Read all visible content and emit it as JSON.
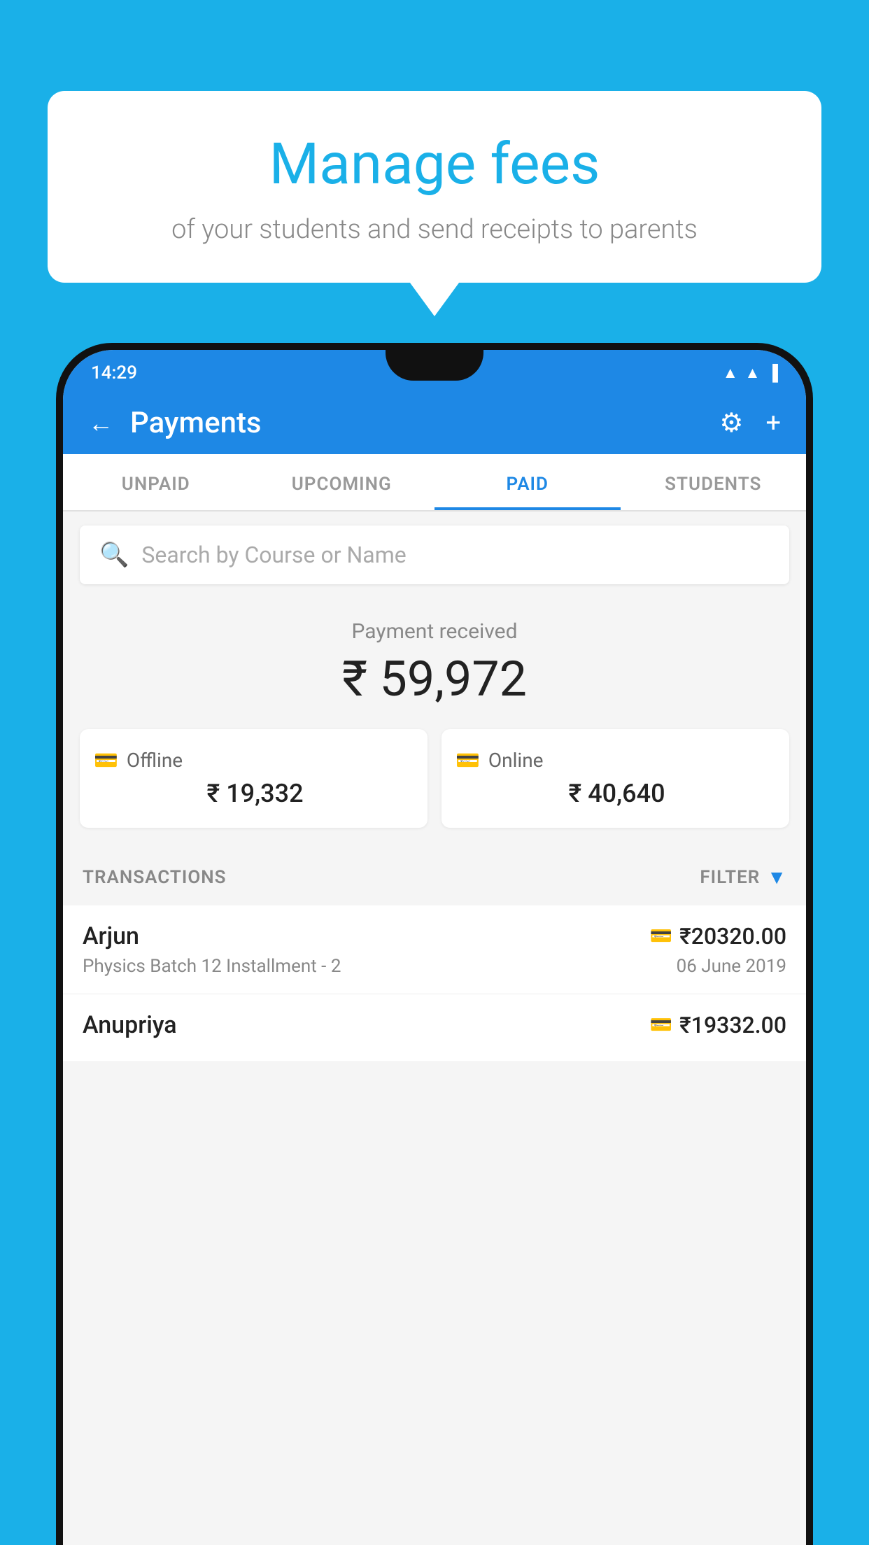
{
  "background_color": "#1ab0e8",
  "bubble": {
    "title": "Manage fees",
    "subtitle": "of your students and send receipts to parents"
  },
  "status_bar": {
    "time": "14:29",
    "wifi": "▲",
    "signal": "▲",
    "battery": "▐"
  },
  "app_bar": {
    "title": "Payments",
    "back_label": "←",
    "gear_symbol": "⚙",
    "plus_symbol": "+"
  },
  "tabs": [
    {
      "label": "UNPAID",
      "active": false
    },
    {
      "label": "UPCOMING",
      "active": false
    },
    {
      "label": "PAID",
      "active": true
    },
    {
      "label": "STUDENTS",
      "active": false
    }
  ],
  "search": {
    "placeholder": "Search by Course or Name"
  },
  "payment_summary": {
    "label": "Payment received",
    "amount": "₹ 59,972",
    "offline_label": "Offline",
    "offline_amount": "₹ 19,332",
    "online_label": "Online",
    "online_amount": "₹ 40,640"
  },
  "transactions": {
    "header_label": "TRANSACTIONS",
    "filter_label": "FILTER",
    "rows": [
      {
        "name": "Arjun",
        "amount": "₹20320.00",
        "description": "Physics Batch 12 Installment - 2",
        "date": "06 June 2019",
        "payment_type": "card"
      },
      {
        "name": "Anupriya",
        "amount": "₹19332.00",
        "description": "",
        "date": "",
        "payment_type": "offline"
      }
    ]
  }
}
